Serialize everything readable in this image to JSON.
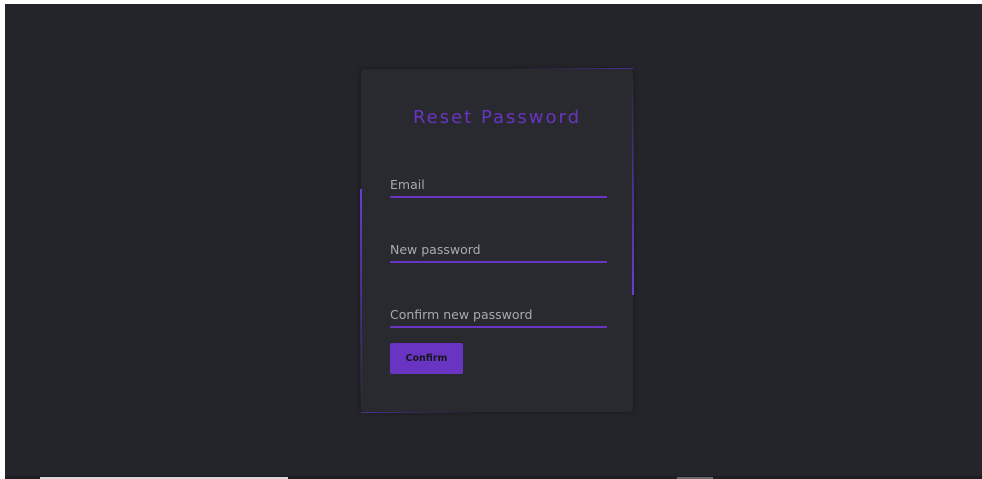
{
  "form": {
    "title": "Reset Password",
    "email_placeholder": "Email",
    "new_password_placeholder": "New password",
    "confirm_password_placeholder": "Confirm new password",
    "submit_label": "Confirm"
  },
  "colors": {
    "background": "#24252a",
    "card": "#282a2f",
    "accent": "#6a34c2"
  }
}
